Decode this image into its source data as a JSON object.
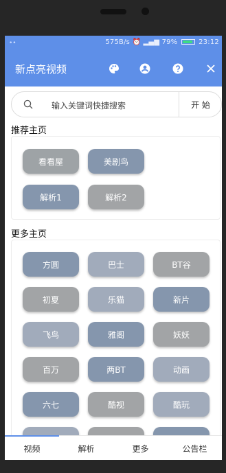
{
  "statusbar": {
    "dot": "••",
    "network": "575B/s",
    "battery_text": "79%",
    "battery_level": 0.79,
    "time": "23:12"
  },
  "appbar": {
    "title": "新点亮视频",
    "icons": [
      "palette-icon",
      "account-icon",
      "help-icon",
      "close-icon"
    ]
  },
  "search": {
    "placeholder": "输入关键词快捷搜索",
    "button": "开 始"
  },
  "recommended": {
    "title": "推荐主页",
    "items": [
      {
        "label": "看看屋",
        "color": "#9ea3a6"
      },
      {
        "label": "美剧鸟",
        "color": "#8596ad"
      },
      {
        "label": "解析1",
        "color": "#8596ad"
      },
      {
        "label": "解析2",
        "color": "#a2a4a6"
      }
    ]
  },
  "more": {
    "title": "更多主页",
    "items": [
      {
        "label": "方圆",
        "color": "#8596ad"
      },
      {
        "label": "巴士",
        "color": "#a1abbb"
      },
      {
        "label": "BT谷",
        "color": "#a2a4a6"
      },
      {
        "label": "初夏",
        "color": "#a2a4a6"
      },
      {
        "label": "乐猫",
        "color": "#a1abbb"
      },
      {
        "label": "新片",
        "color": "#8596ad"
      },
      {
        "label": "飞鸟",
        "color": "#a1abbb"
      },
      {
        "label": "雅阁",
        "color": "#8596ad"
      },
      {
        "label": "妖妖",
        "color": "#a2a4a6"
      },
      {
        "label": "百万",
        "color": "#a2a4a6"
      },
      {
        "label": "两BT",
        "color": "#8596ad"
      },
      {
        "label": "动画",
        "color": "#a1abbb"
      },
      {
        "label": "六七",
        "color": "#8596ad"
      },
      {
        "label": "酷视",
        "color": "#a2a4a6"
      },
      {
        "label": "酷玩",
        "color": "#a1abbb"
      },
      {
        "label": "",
        "color": "#a1abbb"
      },
      {
        "label": "",
        "color": "#a2a4a6"
      },
      {
        "label": "",
        "color": "#8596ad"
      }
    ]
  },
  "tabs": [
    {
      "label": "视频"
    },
    {
      "label": "解析"
    },
    {
      "label": "更多"
    },
    {
      "label": "公告栏"
    }
  ],
  "colors": {
    "accent": "#5e8fe8"
  }
}
